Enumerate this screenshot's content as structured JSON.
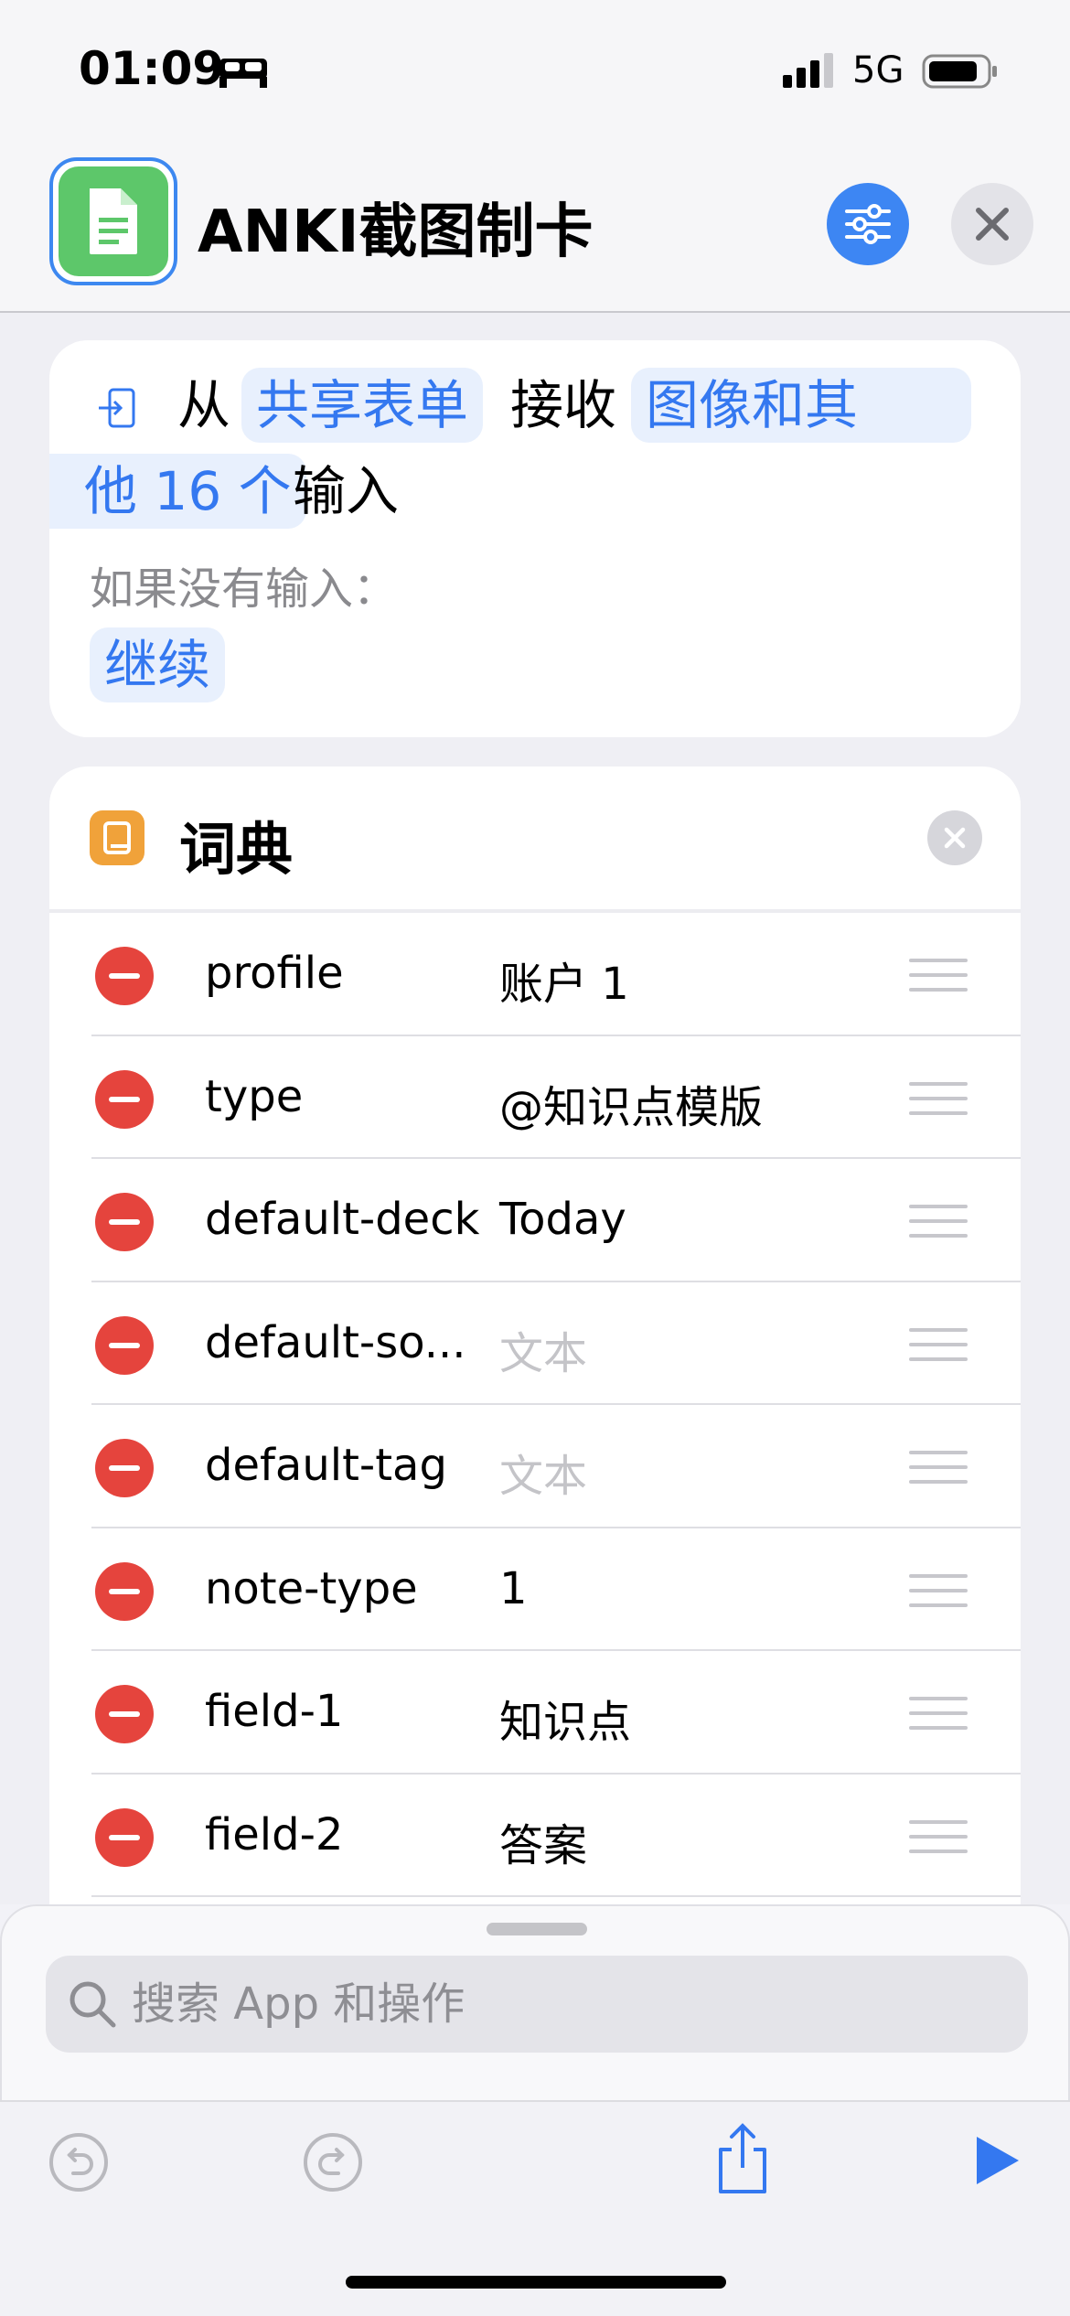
{
  "status_bar": {
    "time": "01:09",
    "network": "5G"
  },
  "header": {
    "title": "ANKI截图制卡"
  },
  "receive": {
    "from": "从",
    "source": "共享表单",
    "receive": "接收",
    "types_line1": "图像和其",
    "types_line2": "他 16 个",
    "input": "输入",
    "no_input_hint": "如果没有输入：",
    "no_input_action": "继续"
  },
  "dictionary": {
    "title": "词典",
    "rows": [
      {
        "key": "profile",
        "value": "账户 1",
        "placeholder": false
      },
      {
        "key": "type",
        "value": "@知识点模版",
        "placeholder": false
      },
      {
        "key": "default-deck",
        "value": "Today",
        "placeholder": false
      },
      {
        "key": "default-so...",
        "value": "文本",
        "placeholder": true
      },
      {
        "key": "default-tag",
        "value": "文本",
        "placeholder": true
      },
      {
        "key": "note-type",
        "value": "1",
        "placeholder": false
      },
      {
        "key": "field-1",
        "value": "知识点",
        "placeholder": false
      },
      {
        "key": "field-2",
        "value": "答案",
        "placeholder": false
      }
    ]
  },
  "search": {
    "placeholder": "搜索 App 和操作"
  },
  "colors": {
    "accent": "#3478f0",
    "app_icon": "#5dc76a",
    "dict_icon": "#f0a23a",
    "delete": "#e5443d"
  },
  "icons": {
    "status": [
      "bed-icon",
      "signal-icon",
      "battery-icon"
    ],
    "header": [
      "document-icon",
      "sliders-icon",
      "close-icon"
    ],
    "toolbar": [
      "undo-icon",
      "redo-icon",
      "share-icon",
      "play-icon"
    ]
  }
}
